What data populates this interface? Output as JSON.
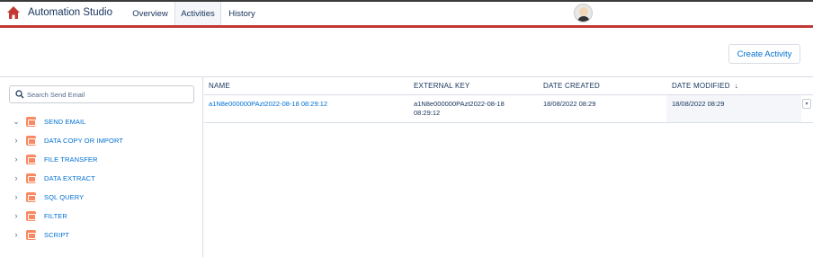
{
  "header": {
    "app_title": "Automation Studio",
    "tabs": [
      {
        "label": "Overview",
        "active": false
      },
      {
        "label": "Activities",
        "active": true
      },
      {
        "label": "History",
        "active": false
      }
    ],
    "accent_color": "#c23934",
    "logo_icon": "home-icon",
    "avatar_icon": "user-avatar-icon"
  },
  "toolbar": {
    "create_label": "Create Activity"
  },
  "sidebar": {
    "search": {
      "placeholder": "Search Send Email",
      "value": ""
    },
    "items": [
      {
        "label": "SEND EMAIL",
        "expanded": true,
        "icon": "send-email-icon"
      },
      {
        "label": "DATA COPY OR IMPORT",
        "expanded": false,
        "icon": "data-copy-icon"
      },
      {
        "label": "FILE TRANSFER",
        "expanded": false,
        "icon": "file-transfer-icon"
      },
      {
        "label": "DATA EXTRACT",
        "expanded": false,
        "icon": "data-extract-icon"
      },
      {
        "label": "SQL QUERY",
        "expanded": false,
        "icon": "sql-query-icon"
      },
      {
        "label": "FILTER",
        "expanded": false,
        "icon": "filter-icon"
      },
      {
        "label": "SCRIPT",
        "expanded": false,
        "icon": "script-icon"
      }
    ]
  },
  "table": {
    "columns": [
      "NAME",
      "EXTERNAL KEY",
      "DATE CREATED",
      "DATE MODIFIED"
    ],
    "sort_indicator": "↓",
    "rows": [
      {
        "name": "a1N8e000000PAzt2022-08-18 08:29:12",
        "external_key_line1": "a1N8e000000PAzt2022-08-18",
        "external_key_line2": "08:29:12",
        "date_created": "18/08/2022 08:29",
        "date_modified": "18/08/2022 08:29"
      }
    ],
    "row_menu_glyph": "▾"
  }
}
